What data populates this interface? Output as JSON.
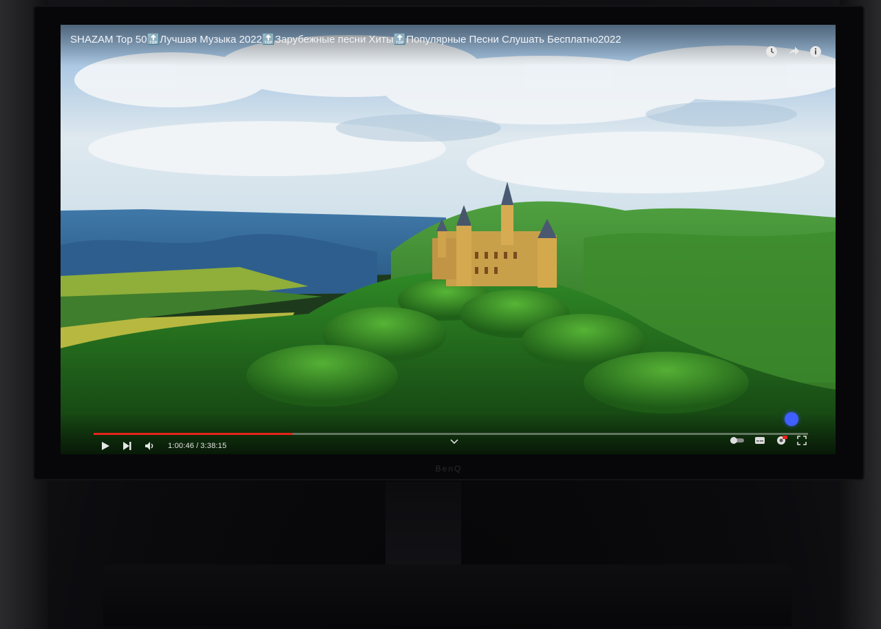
{
  "player": {
    "title": "SHAZAM Top 50🔝Лучшая Музыка 2022🔝Зарубежные песни Хиты🔝Популярные Песни Слушать Бесплатно2022",
    "current_time": "1:00:46",
    "duration": "3:38:15",
    "separator": "/",
    "progress_fraction": 0.278,
    "accent_color": "#e8231b",
    "top_icons": [
      "clock-icon",
      "share-icon",
      "info-icon"
    ],
    "controls": [
      "play-icon",
      "next-icon",
      "volume-icon"
    ],
    "right_controls": [
      "autoplay-toggle-icon",
      "subtitles-icon",
      "settings-icon",
      "fullscreen-icon"
    ]
  },
  "monitor": {
    "brand": "BenQ"
  }
}
